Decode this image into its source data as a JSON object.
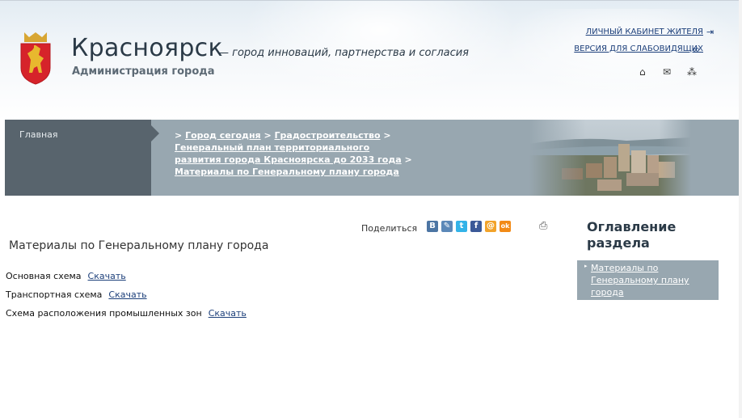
{
  "header": {
    "city_name": "Красноярск",
    "slogan": "— город инноваций, партнерства и согласия",
    "admin_name": "Администрация города",
    "links": {
      "cabinet": "ЛИЧНЫЙ КАБИНЕТ ЖИТЕЛЯ",
      "accessibility": "ВЕРСИЯ ДЛЯ СЛАБОВИДЯЩИХ"
    },
    "tools": [
      "home-icon",
      "mail-icon",
      "sitemap-icon"
    ]
  },
  "breadcrumb": {
    "home": "Главная",
    "items": [
      "Город сегодня",
      "Градостроительство",
      "Генеральный план территориального развития города Красноярска до 2033 года",
      "Материалы по Генеральному плану города"
    ],
    "separator": ">"
  },
  "share": {
    "label": "Поделиться",
    "networks": [
      {
        "name": "vkontakte",
        "glyph": "В",
        "color": "#4c75a3"
      },
      {
        "name": "livejournal",
        "glyph": "✎",
        "color": "#5b88b8"
      },
      {
        "name": "twitter",
        "glyph": "t",
        "color": "#33b3e8"
      },
      {
        "name": "facebook",
        "glyph": "f",
        "color": "#3b5998"
      },
      {
        "name": "mailru",
        "glyph": "@",
        "color": "#f2a32a"
      },
      {
        "name": "odnoklassniki",
        "glyph": "ok",
        "color": "#f28a16"
      }
    ]
  },
  "main": {
    "title": "Материалы по Генеральному плану города",
    "rows": [
      {
        "label": "Основная схема",
        "link": "Скачать"
      },
      {
        "label": "Транспортная схема",
        "link": "Скачать"
      },
      {
        "label": "Схема расположения промышленных зон",
        "link": "Скачать"
      }
    ]
  },
  "sidebar": {
    "title": "Оглавление раздела",
    "items": [
      "Материалы по Генеральному плану города"
    ]
  },
  "colors": {
    "crumb_dark": "#58646d",
    "crumb_light": "#98a7b0",
    "link": "#1c3f7a"
  }
}
